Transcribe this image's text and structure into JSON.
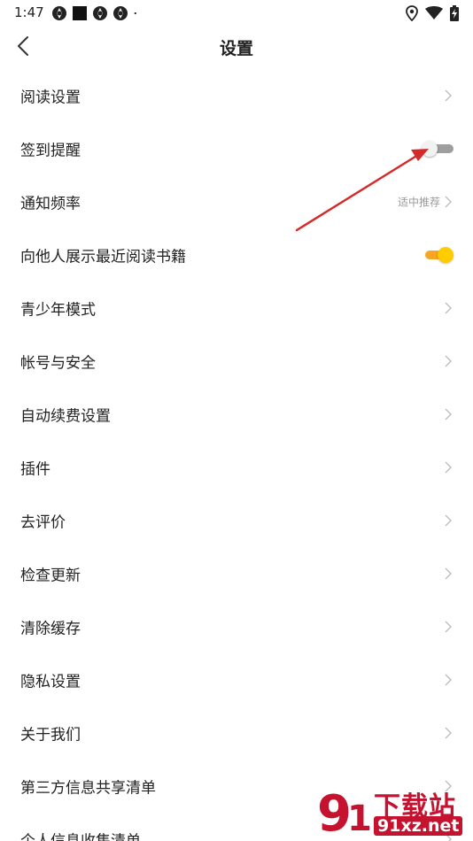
{
  "status_bar": {
    "time": "1:47",
    "left_icons": [
      "aperture-icon",
      "square-icon",
      "aperture-icon",
      "aperture-icon",
      "dot-icon"
    ],
    "right_icons": [
      "location-icon",
      "wifi-icon",
      "battery-charging-icon"
    ]
  },
  "header": {
    "title": "设置",
    "back_icon": "chevron-left-icon"
  },
  "settings": {
    "items": [
      {
        "label": "阅读设置",
        "control": "chevron"
      },
      {
        "label": "签到提醒",
        "control": "toggle",
        "toggle_on": false
      },
      {
        "label": "通知频率",
        "control": "chevron",
        "value": "适中推荐"
      },
      {
        "label": "向他人展示最近阅读书籍",
        "control": "toggle",
        "toggle_on": true
      },
      {
        "label": "青少年模式",
        "control": "chevron"
      },
      {
        "label": "帐号与安全",
        "control": "chevron"
      },
      {
        "label": "自动续费设置",
        "control": "chevron"
      },
      {
        "label": "插件",
        "control": "chevron"
      },
      {
        "label": "去评价",
        "control": "chevron"
      },
      {
        "label": "检查更新",
        "control": "chevron"
      },
      {
        "label": "清除缓存",
        "control": "chevron"
      },
      {
        "label": "隐私设置",
        "control": "chevron"
      },
      {
        "label": "关于我们",
        "control": "chevron"
      },
      {
        "label": "第三方信息共享清单",
        "control": "chevron"
      },
      {
        "label": "个人信息收集清单",
        "control": "chevron"
      }
    ]
  },
  "watermark": {
    "logo_text": "下载站",
    "url_text": "91xz.net"
  },
  "colors": {
    "annotation_arrow": "#d42a2a",
    "toggle_on_track": "#f6a623",
    "toggle_on_knob": "#ffcc00",
    "toggle_off_track": "#9e9e9e",
    "watermark_red": "#c4122f"
  }
}
